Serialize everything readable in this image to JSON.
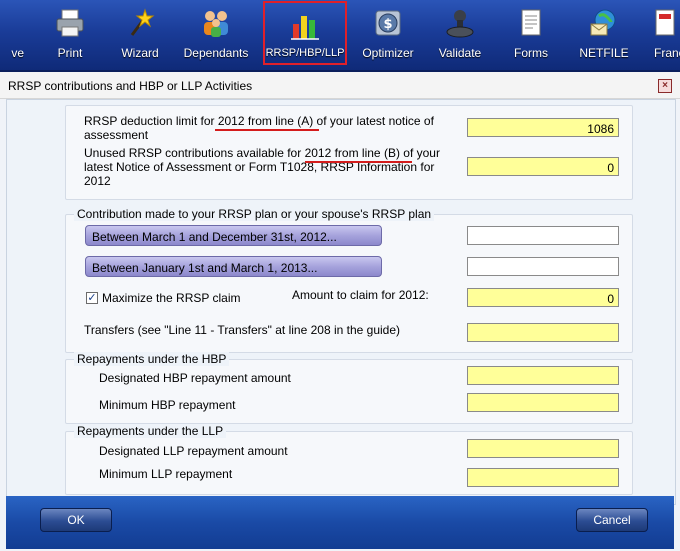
{
  "toolbar": {
    "items": [
      {
        "label": "ve"
      },
      {
        "label": "Print"
      },
      {
        "label": "Wizard"
      },
      {
        "label": "Dependants"
      },
      {
        "label": "RRSP/HBP/LLP"
      },
      {
        "label": "Optimizer"
      },
      {
        "label": "Validate"
      },
      {
        "label": "Forms"
      },
      {
        "label": "NETFILE"
      },
      {
        "label": "Franc"
      }
    ],
    "active_item": "RRSP/HBP/LLP",
    "active_color": "#e0202a"
  },
  "dialog": {
    "title": "RRSP contributions and HBP or LLP Activities",
    "close_glyph": "×"
  },
  "deduction": {
    "limit_label_1": "RRSP deduction limit for 2012 from line (A) of your latest notice of",
    "limit_label_2": "assessment",
    "limit_value": "1086",
    "unused_label_1": "Unused RRSP contributions available for 2012 from line (B) of your",
    "unused_label_2": "latest Notice of Assessment or Form T1028, RRSP Information for",
    "unused_label_3": "2012",
    "unused_value": "0"
  },
  "contribution": {
    "group_title": "Contribution made to your RRSP plan or your spouse's RRSP plan",
    "period1_label": "Between March 1 and December 31st, 2012...",
    "period1_value": "",
    "period2_label": "Between January 1st and March 1, 2013...",
    "period2_value": "",
    "maximize_label": "Maximize the RRSP claim",
    "maximize_checked": true,
    "check_glyph": "✓",
    "claim_label": "Amount to claim for 2012:",
    "claim_value": "0",
    "transfers_label": "Transfers (see \"Line 11 - Transfers\" at line 208 in the guide)",
    "transfers_value": ""
  },
  "hbp": {
    "group_title": "Repayments under the HBP",
    "designated_label": "Designated HBP repayment amount",
    "designated_value": "",
    "minimum_label": "Minimum HBP repayment",
    "minimum_value": ""
  },
  "llp": {
    "group_title": "Repayments under the LLP",
    "designated_label": "Designated LLP repayment amount",
    "designated_value": "",
    "minimum_label": "Minimum LLP repayment",
    "minimum_value": ""
  },
  "footer": {
    "ok_label": "OK",
    "cancel_label": "Cancel"
  },
  "colors": {
    "field_yellow": "#ffff99",
    "annotation_red": "#d41c1c",
    "toolbar_blue": "#1a3c98"
  }
}
